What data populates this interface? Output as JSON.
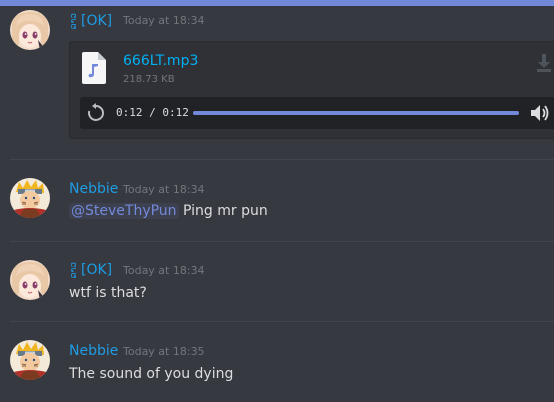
{
  "colors": {
    "background": "#36393f",
    "username": "#1e9de7",
    "link": "#00b0f4",
    "mention_text": "#7289da",
    "progress": "#7289da"
  },
  "messages": [
    {
      "author": "[OK]",
      "author_prefix": "ລາວ",
      "timestamp": "Today at 18:34",
      "attachment": {
        "file_name": "666LT.mp3",
        "file_size": "218.73 KB",
        "player": {
          "time": "0:12 / 0:12",
          "progress_fraction": 1.0
        },
        "icons": [
          "audio-file-icon",
          "download-icon",
          "replay-icon",
          "volume-icon"
        ]
      }
    },
    {
      "author": "Nebbie",
      "timestamp": "Today at 18:34",
      "mention": "@SteveThyPun",
      "text": "Ping mr pun"
    },
    {
      "author": "[OK]",
      "author_prefix": "ລາວ",
      "timestamp": "Today at 18:34",
      "text": "wtf is that?"
    },
    {
      "author": "Nebbie",
      "timestamp": "Today at 18:35",
      "text": "The sound of you dying"
    }
  ]
}
